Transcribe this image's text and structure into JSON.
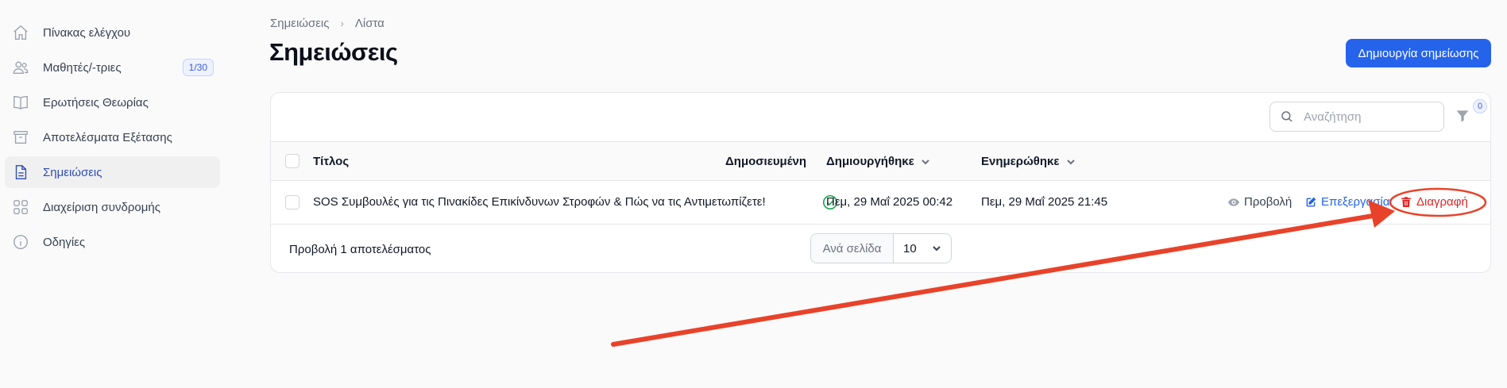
{
  "sidebar": {
    "items": [
      {
        "label": "Πίνακας ελέγχου",
        "icon": "home-icon"
      },
      {
        "label": "Μαθητές/-τριες",
        "icon": "users-icon",
        "badge": "1/30"
      },
      {
        "label": "Ερωτήσεις Θεωρίας",
        "icon": "book-icon"
      },
      {
        "label": "Αποτελέσματα Εξέτασης",
        "icon": "archive-icon"
      },
      {
        "label": "Σημειώσεις",
        "icon": "document-icon",
        "active": true
      },
      {
        "label": "Διαχείριση συνδρομής",
        "icon": "grid-icon"
      },
      {
        "label": "Οδηγίες",
        "icon": "info-icon"
      }
    ]
  },
  "breadcrumb": {
    "parent": "Σημειώσεις",
    "current": "Λίστα"
  },
  "page_title": "Σημειώσεις",
  "create_button": "Δημιουργία σημείωσης",
  "table": {
    "search_placeholder": "Αναζήτηση",
    "filter_count": "0",
    "columns": {
      "title": "Τίτλος",
      "published": "Δημοσιευμένη",
      "created": "Δημιουργήθηκε",
      "updated": "Ενημερώθηκε"
    },
    "rows": [
      {
        "title": "SOS Συμβουλές για τις Πινακίδες Επικίνδυνων Στροφών & Πώς να τις Αντιμετωπίζετε!",
        "published": true,
        "created": "Πεμ, 29 Μαΐ 2025 00:42",
        "updated": "Πεμ, 29 Μαΐ 2025 21:45",
        "actions": {
          "view": "Προβολή",
          "edit": "Επεξεργασία",
          "delete": "Διαγραφή"
        }
      }
    ],
    "footer": {
      "results_text": "Προβολή 1 αποτελέσματος",
      "per_page_label": "Ανά σελίδα",
      "per_page_value": "10"
    }
  },
  "colors": {
    "primary": "#2563eb",
    "danger": "#dc2626",
    "success": "#16a34a",
    "annotation": "#e8432a"
  }
}
